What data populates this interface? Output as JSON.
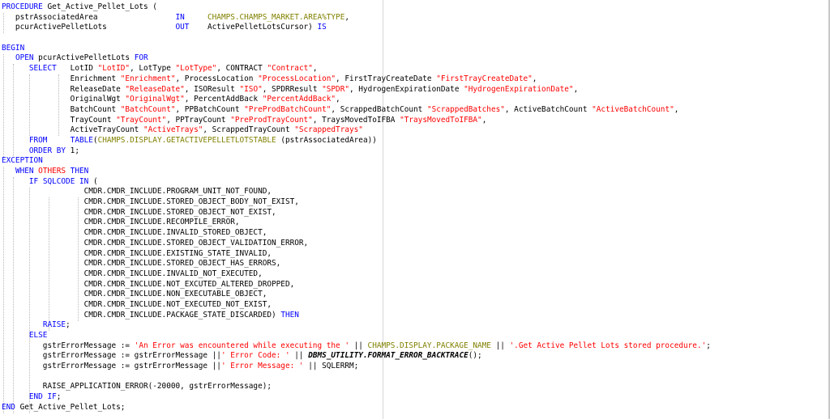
{
  "colors": {
    "keyword": "#0000ff",
    "string": "#ff0000",
    "type_ref": "#808000",
    "plain": "#000000",
    "background": "#ffffff"
  },
  "code_lines": [
    [
      {
        "t": "kw",
        "v": "PROCEDURE"
      },
      {
        "t": "plain",
        "v": " Get_Active_Pellet_Lots ("
      }
    ],
    [
      {
        "t": "plain",
        "v": "   pstrAssociatedArea                 "
      },
      {
        "t": "kw",
        "v": "IN"
      },
      {
        "t": "plain",
        "v": "     "
      },
      {
        "t": "type",
        "v": "CHAMPS.CHAMPS_MARKET.AREA%TYPE"
      },
      {
        "t": "plain",
        "v": ","
      }
    ],
    [
      {
        "t": "plain",
        "v": "   pcurActivePelletLots               "
      },
      {
        "t": "kw",
        "v": "OUT"
      },
      {
        "t": "plain",
        "v": "    ActivePelletLotsCursor) "
      },
      {
        "t": "kw",
        "v": "IS"
      }
    ],
    [
      {
        "t": "plain",
        "v": ""
      }
    ],
    [
      {
        "t": "kw",
        "v": "BEGIN"
      }
    ],
    [
      {
        "t": "plain",
        "v": "   "
      },
      {
        "t": "kw",
        "v": "OPEN"
      },
      {
        "t": "plain",
        "v": " pcurActivePelletLots "
      },
      {
        "t": "kw",
        "v": "FOR"
      }
    ],
    [
      {
        "t": "plain",
        "v": "      "
      },
      {
        "t": "kw",
        "v": "SELECT"
      },
      {
        "t": "plain",
        "v": "   LotID "
      },
      {
        "t": "str",
        "v": "\"LotID\""
      },
      {
        "t": "plain",
        "v": ", LotType "
      },
      {
        "t": "str",
        "v": "\"LotType\""
      },
      {
        "t": "plain",
        "v": ", CONTRACT "
      },
      {
        "t": "str",
        "v": "\"Contract\""
      },
      {
        "t": "plain",
        "v": ","
      }
    ],
    [
      {
        "t": "plain",
        "v": "               Enrichment "
      },
      {
        "t": "str",
        "v": "\"Enrichment\""
      },
      {
        "t": "plain",
        "v": ", ProcessLocation "
      },
      {
        "t": "str",
        "v": "\"ProcessLocation\""
      },
      {
        "t": "plain",
        "v": ", FirstTrayCreateDate "
      },
      {
        "t": "str",
        "v": "\"FirstTrayCreateDate\""
      },
      {
        "t": "plain",
        "v": ","
      }
    ],
    [
      {
        "t": "plain",
        "v": "               ReleaseDate "
      },
      {
        "t": "str",
        "v": "\"ReleaseDate\""
      },
      {
        "t": "plain",
        "v": ", ISOResult "
      },
      {
        "t": "str",
        "v": "\"ISO\""
      },
      {
        "t": "plain",
        "v": ", SPDRResult "
      },
      {
        "t": "str",
        "v": "\"SPDR\""
      },
      {
        "t": "plain",
        "v": ", HydrogenExpirationDate "
      },
      {
        "t": "str",
        "v": "\"HydrogenExpirationDate\""
      },
      {
        "t": "plain",
        "v": ","
      }
    ],
    [
      {
        "t": "plain",
        "v": "               OriginalWgt "
      },
      {
        "t": "str",
        "v": "\"OriginalWgt\""
      },
      {
        "t": "plain",
        "v": ", PercentAddBack "
      },
      {
        "t": "str",
        "v": "\"PercentAddBack\""
      },
      {
        "t": "plain",
        "v": ","
      }
    ],
    [
      {
        "t": "plain",
        "v": "               BatchCount "
      },
      {
        "t": "str",
        "v": "\"BatchCount\""
      },
      {
        "t": "plain",
        "v": ", PPBatchCount "
      },
      {
        "t": "str",
        "v": "\"PreProdBatchCount\""
      },
      {
        "t": "plain",
        "v": ", ScrappedBatchCount "
      },
      {
        "t": "str",
        "v": "\"ScrappedBatches\""
      },
      {
        "t": "plain",
        "v": ", ActiveBatchCount "
      },
      {
        "t": "str",
        "v": "\"ActiveBatchCount\""
      },
      {
        "t": "plain",
        "v": ","
      }
    ],
    [
      {
        "t": "plain",
        "v": "               TrayCount "
      },
      {
        "t": "str",
        "v": "\"TrayCount\""
      },
      {
        "t": "plain",
        "v": ", PPTrayCount "
      },
      {
        "t": "str",
        "v": "\"PreProdTrayCount\""
      },
      {
        "t": "plain",
        "v": ", TraysMovedToIFBA "
      },
      {
        "t": "str",
        "v": "\"TraysMovedToIFBA\""
      },
      {
        "t": "plain",
        "v": ","
      }
    ],
    [
      {
        "t": "plain",
        "v": "               ActiveTrayCount "
      },
      {
        "t": "str",
        "v": "\"ActiveTrays\""
      },
      {
        "t": "plain",
        "v": ", ScrappedTrayCount "
      },
      {
        "t": "str",
        "v": "\"ScrappedTrays\""
      }
    ],
    [
      {
        "t": "plain",
        "v": "      "
      },
      {
        "t": "kw",
        "v": "FROM"
      },
      {
        "t": "plain",
        "v": "     "
      },
      {
        "t": "kw",
        "v": "TABLE"
      },
      {
        "t": "plain",
        "v": "("
      },
      {
        "t": "type",
        "v": "CHAMPS.DISPLAY.GETACTIVEPELLETLOTSTABLE"
      },
      {
        "t": "plain",
        "v": " (pstrAssociatedArea))"
      }
    ],
    [
      {
        "t": "plain",
        "v": "      "
      },
      {
        "t": "kw",
        "v": "ORDER BY"
      },
      {
        "t": "plain",
        "v": " 1;"
      }
    ],
    [
      {
        "t": "kw",
        "v": "EXCEPTION"
      }
    ],
    [
      {
        "t": "plain",
        "v": "   "
      },
      {
        "t": "kw",
        "v": "WHEN"
      },
      {
        "t": "plain",
        "v": " "
      },
      {
        "t": "str",
        "v": "OTHERS"
      },
      {
        "t": "plain",
        "v": " "
      },
      {
        "t": "kw",
        "v": "THEN"
      }
    ],
    [
      {
        "t": "plain",
        "v": "      "
      },
      {
        "t": "kw",
        "v": "IF"
      },
      {
        "t": "plain",
        "v": " "
      },
      {
        "t": "kw",
        "v": "SQLCODE"
      },
      {
        "t": "plain",
        "v": " "
      },
      {
        "t": "kw",
        "v": "IN"
      },
      {
        "t": "plain",
        "v": " ("
      }
    ],
    [
      {
        "t": "plain",
        "v": "                  CMDR.CMDR_INCLUDE.PROGRAM_UNIT_NOT_FOUND,"
      }
    ],
    [
      {
        "t": "plain",
        "v": "                  CMDR.CMDR_INCLUDE.STORED_OBJECT_BODY_NOT_EXIST,"
      }
    ],
    [
      {
        "t": "plain",
        "v": "                  CMDR.CMDR_INCLUDE.STORED_OBJECT_NOT_EXIST,"
      }
    ],
    [
      {
        "t": "plain",
        "v": "                  CMDR.CMDR_INCLUDE.RECOMPILE_ERROR,"
      }
    ],
    [
      {
        "t": "plain",
        "v": "                  CMDR.CMDR_INCLUDE.INVALID_STORED_OBJECT,"
      }
    ],
    [
      {
        "t": "plain",
        "v": "                  CMDR.CMDR_INCLUDE.STORED_OBJECT_VALIDATION_ERROR,"
      }
    ],
    [
      {
        "t": "plain",
        "v": "                  CMDR.CMDR_INCLUDE.EXISTING_STATE_INVALID,"
      }
    ],
    [
      {
        "t": "plain",
        "v": "                  CMDR.CMDR_INCLUDE.STORED_OBJECT_HAS_ERRORS,"
      }
    ],
    [
      {
        "t": "plain",
        "v": "                  CMDR.CMDR_INCLUDE.INVALID_NOT_EXECUTED,"
      }
    ],
    [
      {
        "t": "plain",
        "v": "                  CMDR.CMDR_INCLUDE.NOT_EXCUTED_ALTERED_DROPPED,"
      }
    ],
    [
      {
        "t": "plain",
        "v": "                  CMDR.CMDR_INCLUDE.NON_EXECUTABLE_OBJECT,"
      }
    ],
    [
      {
        "t": "plain",
        "v": "                  CMDR.CMDR_INCLUDE.NOT_EXECUTED_NOT_EXIST,"
      }
    ],
    [
      {
        "t": "plain",
        "v": "                  CMDR.CMDR_INCLUDE.PACKAGE_STATE_DISCARDED) "
      },
      {
        "t": "kw",
        "v": "THEN"
      }
    ],
    [
      {
        "t": "plain",
        "v": "         "
      },
      {
        "t": "kw",
        "v": "RAISE"
      },
      {
        "t": "plain",
        "v": ";"
      }
    ],
    [
      {
        "t": "plain",
        "v": "      "
      },
      {
        "t": "kw",
        "v": "ELSE"
      }
    ],
    [
      {
        "t": "plain",
        "v": "         gstrErrorMessage := "
      },
      {
        "t": "str",
        "v": "'An Error was encountered while executing the '"
      },
      {
        "t": "plain",
        "v": " || "
      },
      {
        "t": "type",
        "v": "CHAMPS.DISPLAY.PACKAGE_NAME"
      },
      {
        "t": "plain",
        "v": " || "
      },
      {
        "t": "str",
        "v": "'.Get Active Pellet Lots stored procedure.'"
      },
      {
        "t": "plain",
        "v": ";"
      }
    ],
    [
      {
        "t": "plain",
        "v": "         gstrErrorMessage := gstrErrorMessage ||"
      },
      {
        "t": "str",
        "v": "' Error Code: '"
      },
      {
        "t": "plain",
        "v": " || "
      },
      {
        "t": "bi",
        "v": "DBMS_UTILITY.FORMAT_ERROR_BACKTRACE"
      },
      {
        "t": "plain",
        "v": "();"
      }
    ],
    [
      {
        "t": "plain",
        "v": "         gstrErrorMessage := gstrErrorMessage ||"
      },
      {
        "t": "str",
        "v": "' Error Message: '"
      },
      {
        "t": "plain",
        "v": " || SQLERRM;"
      }
    ],
    [
      {
        "t": "plain",
        "v": ""
      }
    ],
    [
      {
        "t": "plain",
        "v": "         RAISE_APPLICATION_ERROR(-20000, gstrErrorMessage);"
      }
    ],
    [
      {
        "t": "plain",
        "v": "      "
      },
      {
        "t": "kw",
        "v": "END IF"
      },
      {
        "t": "plain",
        "v": ";"
      }
    ],
    [
      {
        "t": "kw",
        "v": "END"
      },
      {
        "t": "plain",
        "v": " Get_Active_Pellet_Lots;"
      }
    ]
  ]
}
